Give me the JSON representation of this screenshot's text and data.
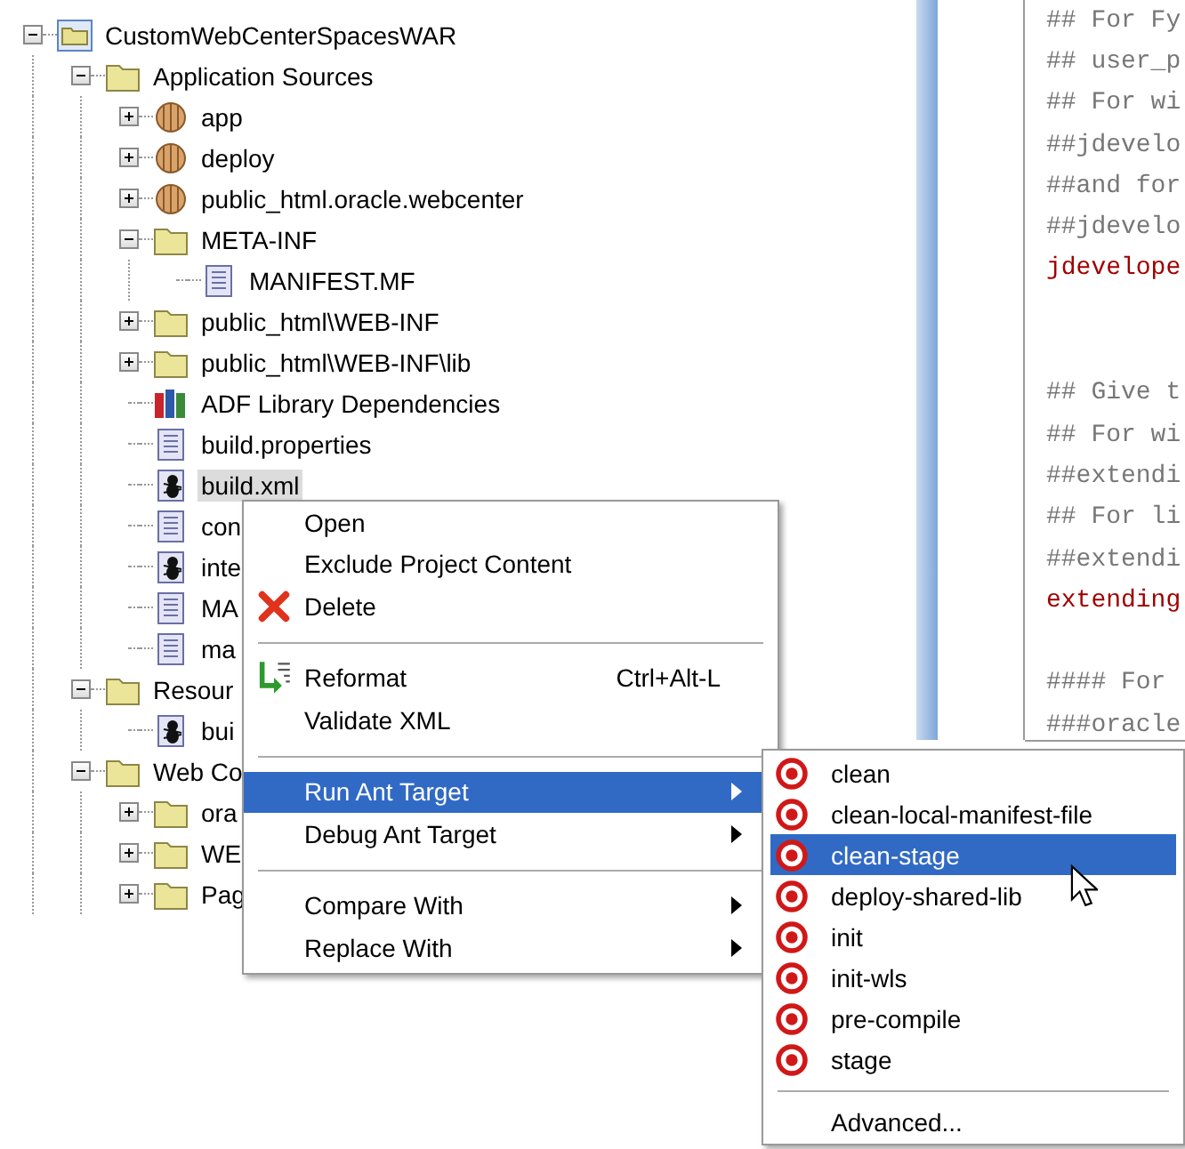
{
  "tree": [
    {
      "label": "CustomWebCenterSpacesWAR",
      "kind": "project",
      "expanded": true,
      "children": [
        {
          "label": "Application Sources",
          "kind": "folder",
          "expanded": true,
          "children": [
            {
              "label": "app",
              "kind": "package",
              "expanded": false
            },
            {
              "label": "deploy",
              "kind": "package",
              "expanded": false
            },
            {
              "label": "public_html.oracle.webcenter",
              "kind": "package",
              "expanded": false
            },
            {
              "label": "META-INF",
              "kind": "folder",
              "expanded": true,
              "children": [
                {
                  "label": "MANIFEST.MF",
                  "kind": "file"
                }
              ]
            },
            {
              "label": "public_html\\WEB-INF",
              "kind": "folder",
              "expanded": false
            },
            {
              "label": "public_html\\WEB-INF\\lib",
              "kind": "folder",
              "expanded": false
            },
            {
              "label": "ADF Library Dependencies",
              "kind": "library"
            },
            {
              "label": "build.properties",
              "kind": "file"
            },
            {
              "label": "build.xml",
              "kind": "ant-file",
              "selected": true
            },
            {
              "label": "con",
              "kind": "file",
              "selected": false
            },
            {
              "label": "inte",
              "kind": "ant-file",
              "selected": false
            },
            {
              "label": "MA",
              "kind": "file",
              "selected": false
            },
            {
              "label": "ma",
              "kind": "file",
              "selected": false
            }
          ]
        },
        {
          "label": "Resour",
          "kind": "folder",
          "expanded": true,
          "children": [
            {
              "label": "bui",
              "kind": "ant-file"
            }
          ]
        },
        {
          "label": "Web Co",
          "kind": "folder",
          "expanded": true,
          "children": [
            {
              "label": "ora",
              "kind": "folder",
              "expanded": false
            },
            {
              "label": "WE",
              "kind": "folder",
              "expanded": false
            },
            {
              "label": "Pag",
              "kind": "folder",
              "expanded": false
            }
          ]
        }
      ]
    }
  ],
  "code_lines": [
    {
      "text": "## For Fy",
      "kind": "comment"
    },
    {
      "text": "## user_p",
      "kind": "comment"
    },
    {
      "text": "## For wi",
      "kind": "comment"
    },
    {
      "text": "##jdevelo",
      "kind": "comment"
    },
    {
      "text": "##and for",
      "kind": "comment"
    },
    {
      "text": "##jdevelo",
      "kind": "comment"
    },
    {
      "text": "jdevelope",
      "kind": "key"
    },
    {
      "kind": "blank"
    },
    {
      "kind": "blank"
    },
    {
      "text": "## Give t",
      "kind": "comment"
    },
    {
      "text": "## For wi",
      "kind": "comment"
    },
    {
      "text": "##extendi",
      "kind": "comment"
    },
    {
      "text": "## For li",
      "kind": "comment"
    },
    {
      "text": "##extendi",
      "kind": "comment"
    },
    {
      "text": "extending",
      "kind": "key"
    },
    {
      "kind": "blank"
    },
    {
      "text": "#### For",
      "kind": "comment"
    },
    {
      "text": "###oracle",
      "kind": "comment"
    }
  ],
  "context_menu": [
    {
      "kind": "item",
      "label": "Open",
      "selected": false
    },
    {
      "kind": "item",
      "label": "Exclude Project Content",
      "selected": false
    },
    {
      "kind": "delete",
      "label": "Delete",
      "selected": false
    },
    {
      "kind": "separator"
    },
    {
      "kind": "reformat",
      "label": "Reformat",
      "shortcut": "Ctrl+Alt-L",
      "selected": false
    },
    {
      "kind": "item",
      "label": "Validate XML",
      "selected": false
    },
    {
      "kind": "separator"
    },
    {
      "kind": "submenu",
      "label": "Run Ant Target",
      "selected": true
    },
    {
      "kind": "submenu",
      "label": "Debug Ant Target",
      "selected": false
    },
    {
      "kind": "separator"
    },
    {
      "kind": "submenu",
      "label": "Compare With",
      "selected": false
    },
    {
      "kind": "submenu",
      "label": "Replace With",
      "selected": false
    }
  ],
  "submenu": [
    {
      "kind": "target",
      "label": "clean",
      "selected": false
    },
    {
      "kind": "target",
      "label": "clean-local-manifest-file",
      "selected": false
    },
    {
      "kind": "target",
      "label": "clean-stage",
      "selected": true
    },
    {
      "kind": "target",
      "label": "deploy-shared-lib",
      "selected": false
    },
    {
      "kind": "target",
      "label": "init",
      "selected": false
    },
    {
      "kind": "target",
      "label": "init-wls",
      "selected": false
    },
    {
      "kind": "target",
      "label": "pre-compile",
      "selected": false
    },
    {
      "kind": "target",
      "label": "stage",
      "selected": false
    },
    {
      "kind": "separator"
    },
    {
      "kind": "item",
      "label": "Advanced...",
      "selected": false
    }
  ]
}
